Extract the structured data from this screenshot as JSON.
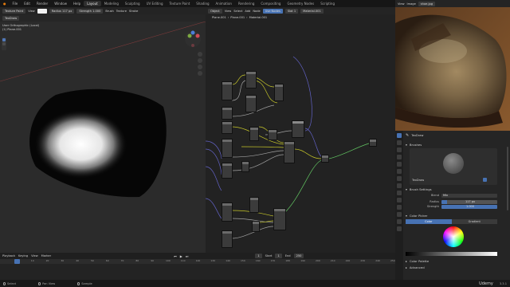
{
  "menu": {
    "items": [
      "File",
      "Edit",
      "Render",
      "Window",
      "Help"
    ],
    "workspaces": [
      "Layout",
      "Modeling",
      "Sculpting",
      "UV Editing",
      "Texture Paint",
      "Shading",
      "Animation",
      "Rendering",
      "Compositing",
      "Geometry Nodes",
      "Scripting"
    ],
    "active_workspace": "Layout"
  },
  "viewport": {
    "mode": "Texture Paint",
    "tool": "TexDraw",
    "radius_label": "Radius",
    "radius_value": "117 px",
    "strength_label": "Strength",
    "strength_value": "1.000",
    "view_info": "User Orthographic (Local)",
    "object_info": "(1) Plane.001",
    "brush_menu": "Brush",
    "texture_menu": "Texture",
    "stroke_menu": "Stroke",
    "falloff_menu": "Falloff",
    "cursor_menu": "Cursor",
    "view_menu": "View",
    "add_menu": "Add"
  },
  "node_editor": {
    "header_object": "Object",
    "menus": [
      "View",
      "Select",
      "Add",
      "Node"
    ],
    "use_nodes_label": "Use Nodes",
    "slot": "Slot 1",
    "material": "Material.001",
    "breadcrumb": [
      "Plane.001",
      "Plane.001",
      "Material.001"
    ]
  },
  "ref_image": {
    "menus": [
      "View",
      "Image"
    ],
    "image_name": "shoe.jpg"
  },
  "properties": {
    "brush_name": "TexDraw",
    "section_brushes": "Brushes",
    "section_brush_settings": "Brush Settings",
    "blend_label": "Blend",
    "blend_value": "Mix",
    "radius_label": "Radius",
    "radius_value": "117 px",
    "strength_label": "Strength",
    "strength_value": "1.000",
    "section_color_picker": "Color Picker",
    "color_tab_color": "Color",
    "color_tab_gradient": "Gradient",
    "section_color_palette": "Color Palette",
    "section_advanced": "Advanced",
    "brush_label": "TexDraw"
  },
  "timeline": {
    "menus": [
      "Playback",
      "Keying",
      "View",
      "Marker"
    ],
    "start_label": "Start",
    "start_value": "1",
    "end_label": "End",
    "end_value": "250",
    "current_frame": "1",
    "ruler": [
      "0",
      "10",
      "20",
      "30",
      "40",
      "50",
      "60",
      "70",
      "80",
      "90",
      "100",
      "110",
      "120",
      "130",
      "140",
      "150",
      "160",
      "170",
      "180",
      "190",
      "200",
      "210",
      "220",
      "230",
      "240",
      "250"
    ]
  },
  "statusbar": {
    "select": "Select",
    "pan_view": "Pan View",
    "sample": "Sample",
    "version": "3.3.1",
    "watermark": "Udemy"
  }
}
